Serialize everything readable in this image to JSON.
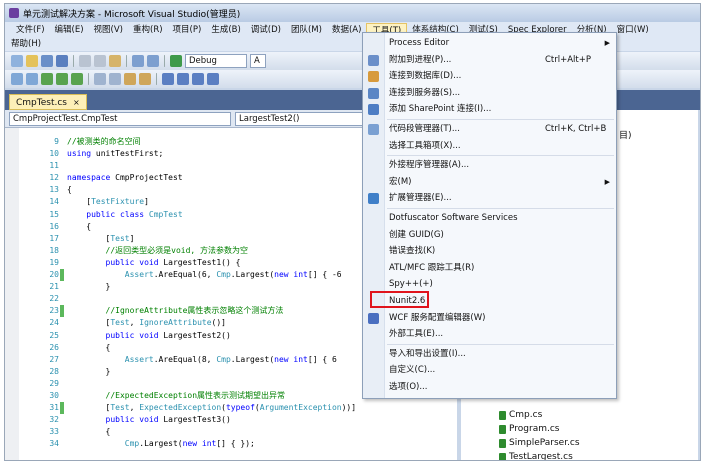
{
  "window": {
    "title": "单元测试解决方案 - Microsoft Visual Studio(管理员)"
  },
  "menubar": [
    {
      "label": "文件(F)"
    },
    {
      "label": "编辑(E)"
    },
    {
      "label": "视图(V)"
    },
    {
      "label": "重构(R)"
    },
    {
      "label": "项目(P)"
    },
    {
      "label": "生成(B)"
    },
    {
      "label": "调试(D)"
    },
    {
      "label": "团队(M)"
    },
    {
      "label": "数据(A)"
    },
    {
      "label": "工具(T)"
    },
    {
      "label": "体系结构(C)"
    },
    {
      "label": "测试(S)"
    },
    {
      "label": "Spec Explorer"
    },
    {
      "label": "分析(N)"
    },
    {
      "label": "窗口(W)"
    }
  ],
  "menubar_row2": {
    "help": "帮助(H)"
  },
  "toolbar": {
    "config": "Debug",
    "platform": "A"
  },
  "tab": {
    "label": "CmpTest.cs",
    "close": "×"
  },
  "nav": {
    "class_box": "CmpProjectTest.CmpTest",
    "member_box": "LargestTest2()"
  },
  "code_lines": [
    {
      "n": "9",
      "code": "//被测类的命名空间"
    },
    {
      "n": "10",
      "code": "using unitTestFirst;"
    },
    {
      "n": "11",
      "code": ""
    },
    {
      "n": "12",
      "code": "namespace CmpProjectTest"
    },
    {
      "n": "13",
      "code": "{"
    },
    {
      "n": "14",
      "code": "    [TestFixture]"
    },
    {
      "n": "15",
      "code": "    public class CmpTest"
    },
    {
      "n": "16",
      "code": "    {"
    },
    {
      "n": "17",
      "code": "        [Test]"
    },
    {
      "n": "18",
      "code": "        //返回类型必须是void, 方法参数为空"
    },
    {
      "n": "19",
      "code": "        public void LargestTest1() {"
    },
    {
      "n": "20",
      "code": "            Assert.AreEqual(6, Cmp.Largest(new int[] { -6"
    },
    {
      "n": "21",
      "code": "        }"
    },
    {
      "n": "22",
      "code": ""
    },
    {
      "n": "23",
      "code": "        //IgnoreAttribute属性表示忽略这个测试方法"
    },
    {
      "n": "24",
      "code": "        [Test, IgnoreAttribute()]"
    },
    {
      "n": "25",
      "code": "        public void LargestTest2()"
    },
    {
      "n": "26",
      "code": "        {"
    },
    {
      "n": "27",
      "code": "            Assert.AreEqual(8, Cmp.Largest(new int[] { 6"
    },
    {
      "n": "28",
      "code": "        }"
    },
    {
      "n": "29",
      "code": ""
    },
    {
      "n": "30",
      "code": "        //ExpectedException属性表示测试期望出异常"
    },
    {
      "n": "31",
      "code": "        [Test, ExpectedException(typeof(ArgumentException))]"
    },
    {
      "n": "32",
      "code": "        public void LargestTest3()"
    },
    {
      "n": "33",
      "code": "        {"
    },
    {
      "n": "34",
      "code": "            Cmp.Largest(new int[] { });"
    }
  ],
  "tools_menu": {
    "items": [
      {
        "label": "Process Editor",
        "shortcut": "",
        "submenu": true
      },
      {
        "label": "附加到进程(P)...",
        "shortcut": "Ctrl+Alt+P"
      },
      {
        "label": "连接到数据库(D)...",
        "shortcut": ""
      },
      {
        "label": "连接到服务器(S)...",
        "shortcut": ""
      },
      {
        "label": "添加 SharePoint 连接(I)...",
        "shortcut": ""
      },
      {
        "label": "代码段管理器(T)...",
        "shortcut": "Ctrl+K, Ctrl+B"
      },
      {
        "label": "选择工具箱项(X)...",
        "shortcut": ""
      },
      {
        "label": "外接程序管理器(A)...",
        "shortcut": ""
      },
      {
        "label": "宏(M)",
        "shortcut": "",
        "submenu": true
      },
      {
        "label": "扩展管理器(E)...",
        "shortcut": ""
      },
      {
        "label": "Dotfuscator Software Services",
        "shortcut": ""
      },
      {
        "label": "创建 GUID(G)",
        "shortcut": ""
      },
      {
        "label": "错误查找(K)",
        "shortcut": ""
      },
      {
        "label": "ATL/MFC 跟踪工具(R)",
        "shortcut": ""
      },
      {
        "label": "Spy++(+)",
        "shortcut": ""
      },
      {
        "label": "Nunit2.6",
        "shortcut": ""
      },
      {
        "label": "WCF 服务配置编辑器(W)",
        "shortcut": ""
      },
      {
        "label": "外部工具(E)...",
        "shortcut": ""
      },
      {
        "label": "导入和导出设置(I)...",
        "shortcut": ""
      },
      {
        "label": "自定义(C)...",
        "shortcut": ""
      },
      {
        "label": "选项(O)...",
        "shortcut": ""
      }
    ]
  },
  "solution_files": [
    {
      "name": "Cmp.cs"
    },
    {
      "name": "Program.cs"
    },
    {
      "name": "SimpleParser.cs"
    },
    {
      "name": "TestLargest.cs"
    }
  ],
  "right_pane_fragment": "目)",
  "colors": {
    "highlight_border": "#e0141c",
    "doc_tab": "#fdf0b8",
    "tab_strip": "#4b6592"
  }
}
